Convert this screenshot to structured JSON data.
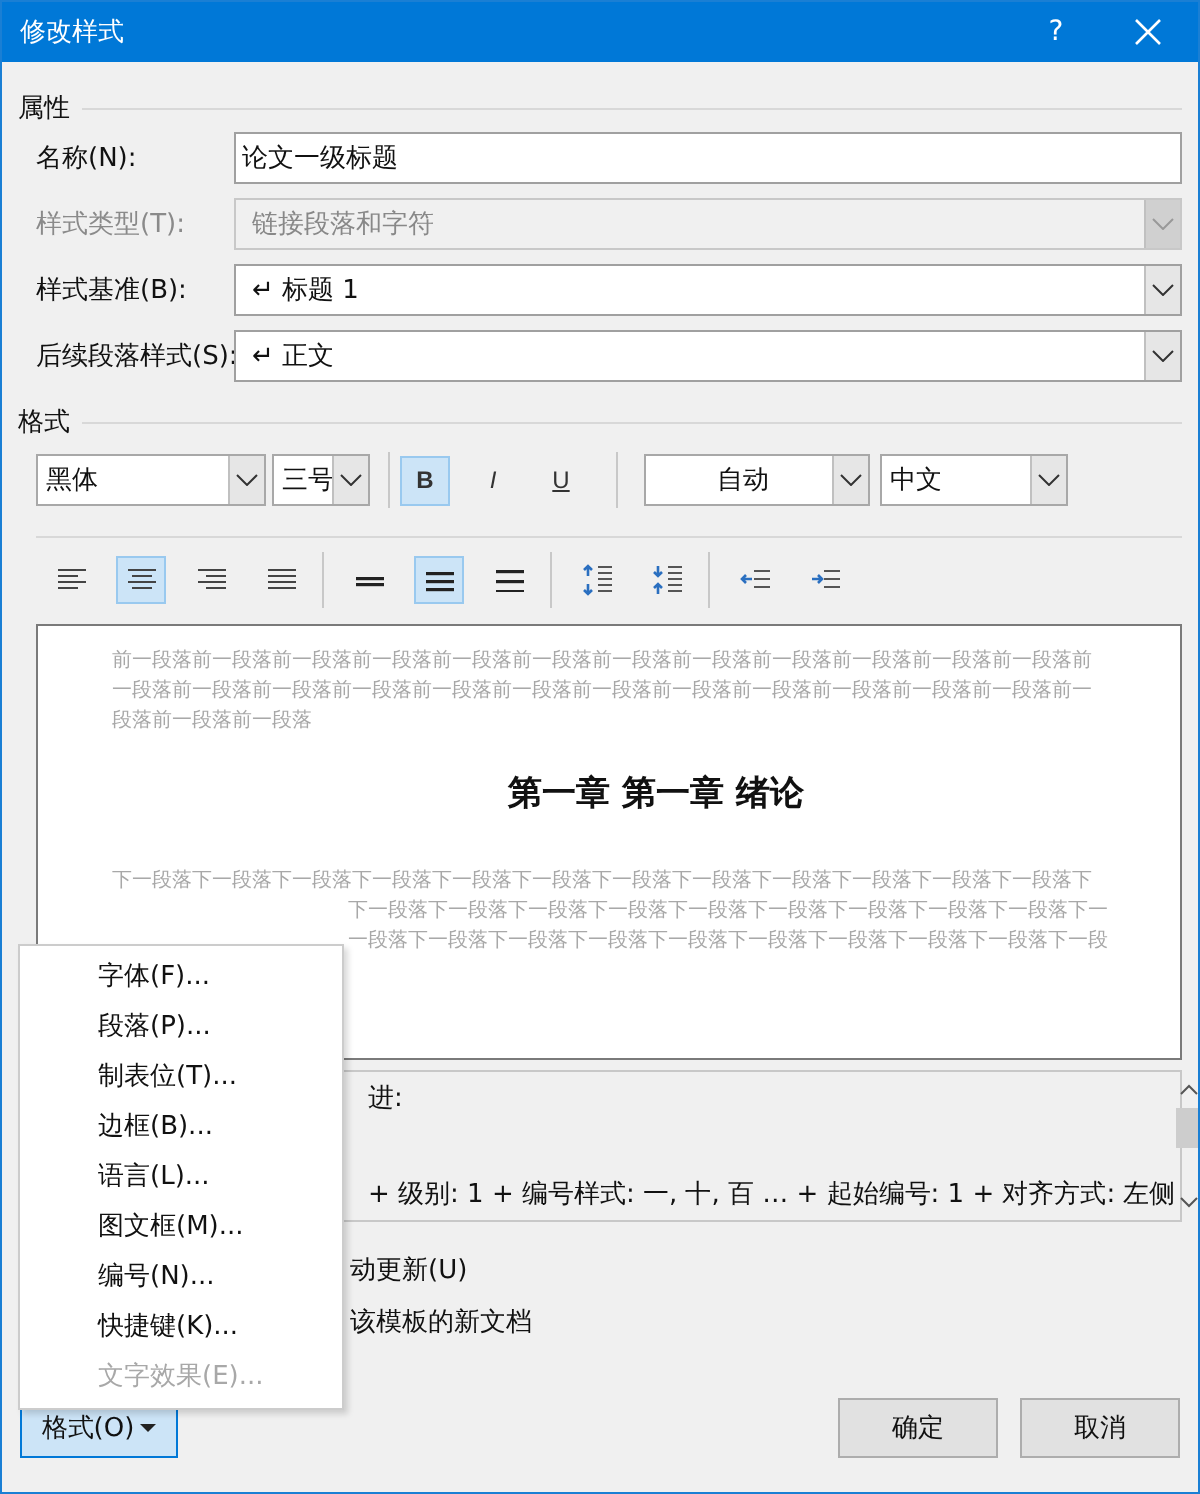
{
  "window": {
    "title": "修改样式",
    "help": "?"
  },
  "properties": {
    "heading": "属性",
    "fields": [
      {
        "label": "名称(N):",
        "value": "论文一级标题",
        "kind": "text",
        "disabled": false
      },
      {
        "label": "样式类型(T):",
        "value": "链接段落和字符",
        "kind": "dropdown",
        "disabled": true
      },
      {
        "label": "样式基准(B):",
        "value": "↵ 标题 1",
        "kind": "dropdown",
        "disabled": false
      },
      {
        "label": "后续段落样式(S):",
        "value": "↵ 正文",
        "kind": "dropdown",
        "disabled": false
      }
    ]
  },
  "format": {
    "heading": "格式",
    "font": "黑体",
    "size": "三号",
    "toggles": [
      {
        "label": "B",
        "kind": "bold",
        "selected": true
      },
      {
        "label": "I",
        "kind": "italic",
        "selected": false
      },
      {
        "label": "U",
        "kind": "underline",
        "selected": false
      }
    ],
    "font_shade": "自动",
    "script": "中文",
    "paragraph": [
      {
        "kind": "left",
        "selected": false
      },
      {
        "kind": "center",
        "selected": true
      },
      {
        "kind": "right",
        "selected": false
      },
      {
        "kind": "justify",
        "selected": false
      },
      {
        "kind": "single",
        "selected": false
      },
      {
        "kind": "onehalf",
        "selected": true
      },
      {
        "kind": "double",
        "selected": false
      },
      {
        "kind": "spacebefore",
        "selected": false
      },
      {
        "kind": "spaceafter",
        "selected": false
      },
      {
        "kind": "outdent",
        "selected": false
      },
      {
        "kind": "indent",
        "selected": false
      }
    ]
  },
  "preview": {
    "before_lines": [
      "前一段落前一段落前一段落前一段落前一段落前一段落前一段落前一段落前一段落前一段落前一段落前一段落前",
      "一段落前一段落前一段落前一段落前一段落前一段落前一段落前一段落前一段落前一段落前一段落前一段落前一",
      "段落前一段落前一段落"
    ],
    "heading": "第一章 第一章 绪论",
    "after_lines": [
      "下一段落下一段落下一段落下一段落下一段落下一段落下一段落下一段落下一段落下一段落下一段落下一段落下",
      "下一段落下一段落下一段落下一段落下一段落下一段落下一段落下一段落下一段落下一",
      "一段落下一段落下一段落下一段落下一段落下一段落下一段落下一段落下一段落下一段"
    ]
  },
  "description": {
    "lines": [
      "进:",
      "+ 级别: 1 + 编号样式: 一, 十, 百 … + 起始编号: 1 + 对齐方式: 左侧"
    ]
  },
  "options": [
    "动更新(U)",
    "该模板的新文档"
  ],
  "menu": {
    "items": [
      {
        "label": "字体(F)...",
        "disabled": false
      },
      {
        "label": "段落(P)...",
        "disabled": false
      },
      {
        "label": "制表位(T)...",
        "disabled": false
      },
      {
        "label": "边框(B)...",
        "disabled": false
      },
      {
        "label": "语言(L)...",
        "disabled": false
      },
      {
        "label": "图文框(M)...",
        "disabled": false
      },
      {
        "label": "编号(N)...",
        "disabled": false
      },
      {
        "label": "快捷键(K)...",
        "disabled": false
      },
      {
        "label": "文字效果(E)...",
        "disabled": true
      }
    ]
  },
  "buttons": {
    "format": "格式(O)",
    "ok": "确定",
    "cancel": "取消"
  }
}
